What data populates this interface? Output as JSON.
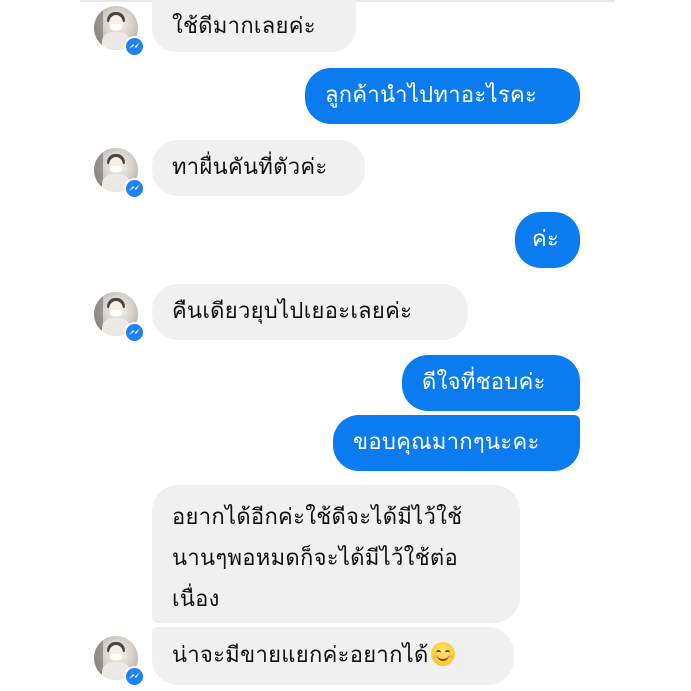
{
  "conversation": {
    "messages": [
      {
        "from": "contact",
        "text": "ใช้ดีมากเลยค่ะ"
      },
      {
        "from": "me",
        "text": "ลูกค้านำไปทาอะไรคะ"
      },
      {
        "from": "contact",
        "text": "ทาผื่นคันที่ตัวค่ะ"
      },
      {
        "from": "me",
        "text": "ค่ะ"
      },
      {
        "from": "contact",
        "text": "คืนเดียวยุบไปเยอะเลยค่ะ"
      },
      {
        "from": "me",
        "text": "ดีใจที่ชอบค่ะ"
      },
      {
        "from": "me",
        "text": "ขอบคุณมากๆนะคะ"
      },
      {
        "from": "contact",
        "lines": [
          "อยากได้อีกค่ะใช้ดีจะได้มีไว้ใช้",
          "นานๆพอหมดก็จะได้มีไว้ใช้ต่อ",
          "เนื่อง"
        ]
      },
      {
        "from": "contact",
        "text": "น่าจะมีขายแยกค่ะอยากได้",
        "emoji": "smiling-face-emoji"
      }
    ]
  },
  "colors": {
    "outgoing_bubble": "#0a7cf0",
    "incoming_bubble": "#f0f0f0",
    "messenger_badge": "#1e82f5"
  },
  "icons": {
    "avatar_badge": "messenger-icon",
    "emoji": "smiling-face-emoji"
  }
}
